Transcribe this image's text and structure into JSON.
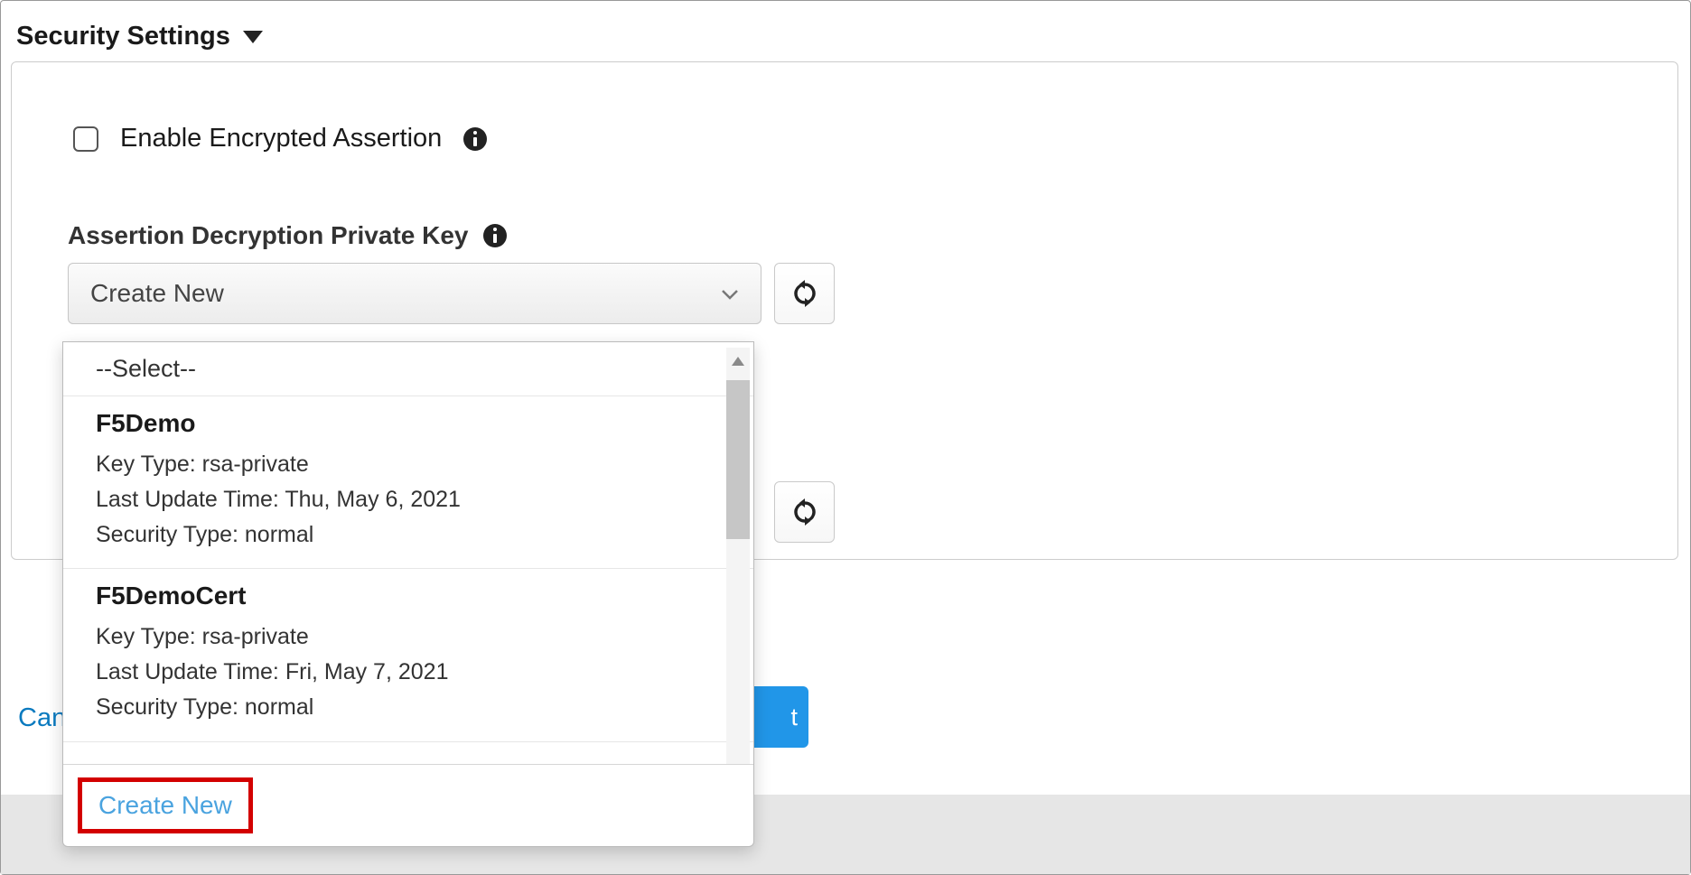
{
  "section": {
    "title": "Security Settings"
  },
  "checkbox": {
    "label": "Enable Encrypted Assertion"
  },
  "field": {
    "label": "Assertion Decryption Private Key",
    "selected": "Create New"
  },
  "dropdown": {
    "select_placeholder": "--Select--",
    "items": [
      {
        "name": "F5Demo",
        "key_type_label": "Key Type:",
        "key_type": "rsa-private",
        "last_update_label": "Last Update Time:",
        "last_update": "Thu, May 6, 2021",
        "security_type_label": "Security Type:",
        "security_type": "normal"
      },
      {
        "name": "F5DemoCert",
        "key_type_label": "Key Type:",
        "key_type": "rsa-private",
        "last_update_label": "Last Update Time:",
        "last_update": "Fri, May 7, 2021",
        "security_type_label": "Security Type:",
        "security_type": "normal"
      }
    ],
    "create_new": "Create New"
  },
  "footer": {
    "cancel": "Can",
    "next": "t"
  }
}
